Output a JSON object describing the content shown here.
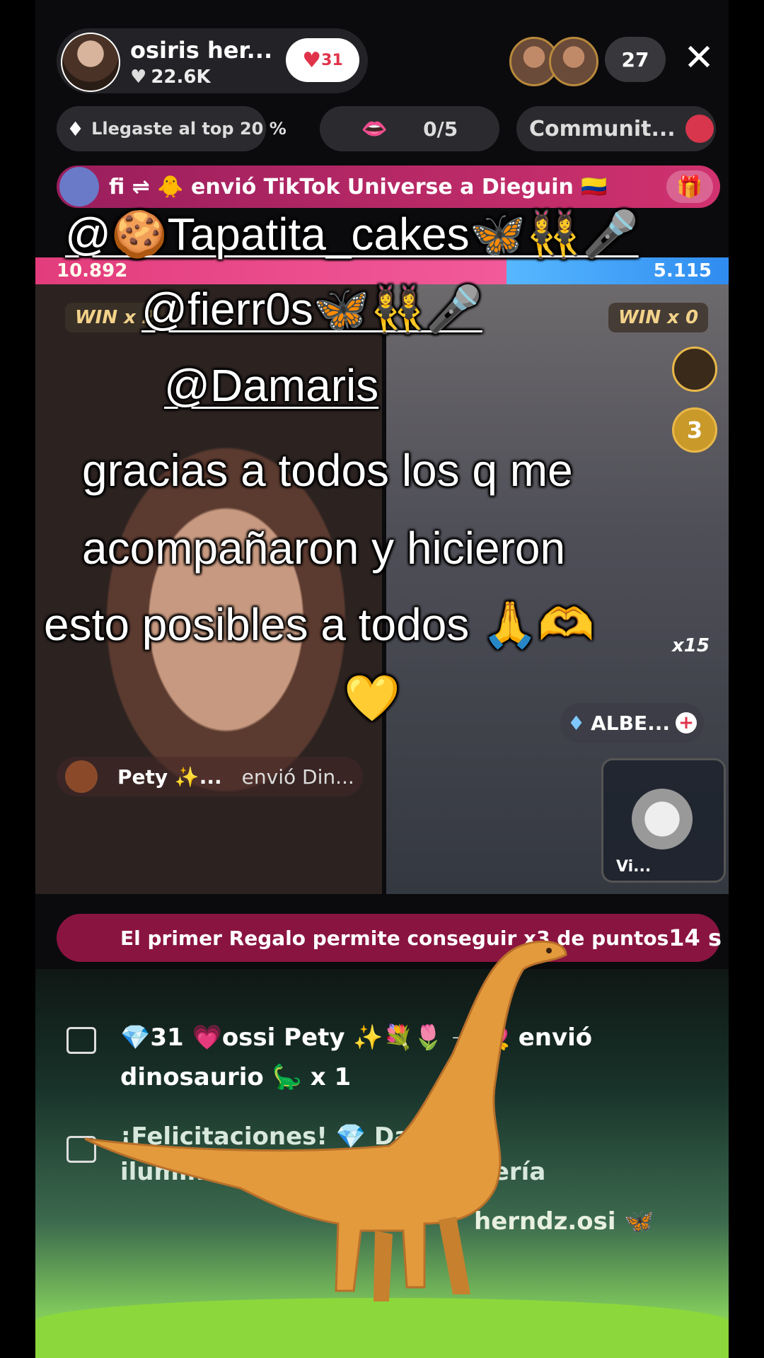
{
  "header": {
    "host_name": "osiris her...",
    "host_likes": "22.6K",
    "follow_badge": "31",
    "viewer_count": "27"
  },
  "pills": {
    "top_rank": "Llegaste al top 20 %",
    "goal": "0/5",
    "community": "Communit..."
  },
  "banner": {
    "text": "fi ⇌ 🐥 envió TikTok Universe a Dieguin 🇨🇴"
  },
  "battle": {
    "left_score": "10.892",
    "right_score": "5.115",
    "left_win": "WIN x 2",
    "right_win": "WIN x 0",
    "badge_number": "3",
    "gift_count": "x15",
    "gifter_tag": "ALBE...",
    "cohost_name": "Vi...",
    "gift_notice_user": "Pety ✨...",
    "gift_notice_action": "envió Din..."
  },
  "caption": {
    "mention1": "@🍪Tapatita_cakes🦋👯‍♀️🎤",
    "mention2": "@fierr0s🦋👯‍♀️🎤",
    "mention3": "@Damaris",
    "line1": "gracias a todos los q me",
    "line2": "acompañaron y hicieron",
    "line3": "esto posibles a todos 🙏🫶",
    "line4": "💛"
  },
  "promo": {
    "text": "El primer Regalo permite conseguir x3 de puntos",
    "seconds": "14 s"
  },
  "chat": [
    {
      "text": "💎31  💗ossi  Pety ✨💐🌷 ➝ 💘 envió"
    },
    {
      "text": "dinosaurio 🦕 x 1"
    },
    {
      "text": "¡Felicitaciones! 💎  Damaris"
    },
    {
      "text": "iluminó Ballena ... en la Galería"
    },
    {
      "text": "herndz.osi 🦋"
    }
  ],
  "colors": {
    "banner": "#c72b68",
    "score_left": "#e23c7c",
    "score_right": "#2f8cf0",
    "timer_bar": "#8a1440",
    "dino": "#e39a3c"
  }
}
